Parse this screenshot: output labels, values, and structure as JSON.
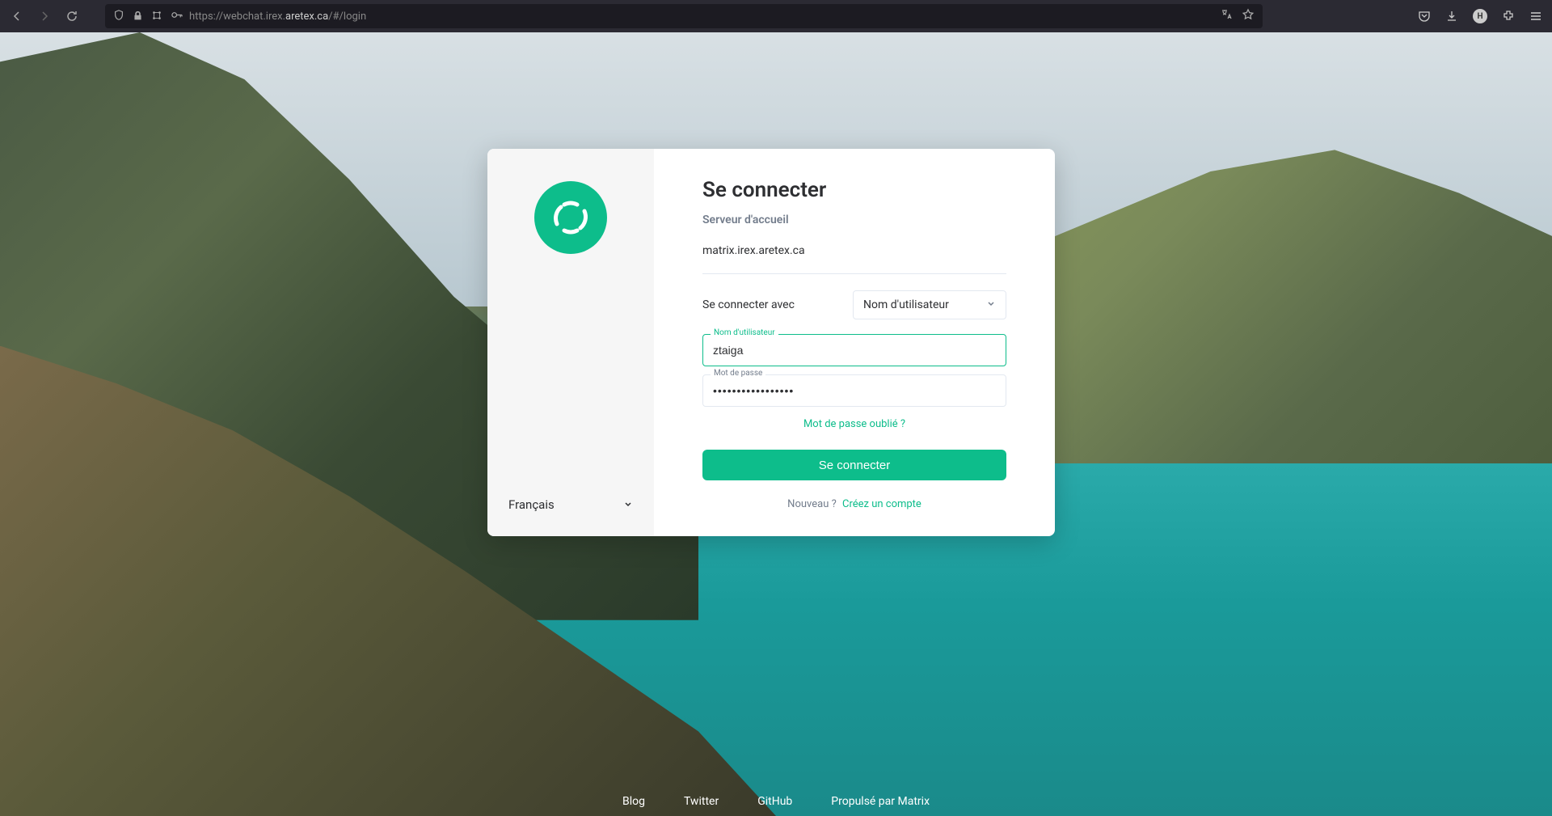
{
  "browser": {
    "url_prefix": "https://webchat.irex.",
    "url_bold": "aretex.ca",
    "url_suffix": "/#/login"
  },
  "login": {
    "heading": "Se connecter",
    "homeserver_label": "Serveur d'accueil",
    "homeserver": "matrix.irex.aretex.ca",
    "method_label": "Se connecter avec",
    "method_value": "Nom d'utilisateur",
    "username_label": "Nom d'utilisateur",
    "username_value": "ztaiga",
    "password_label": "Mot de passe",
    "password_value": "•••••••••••••••••",
    "forgot": "Mot de passe oublié ?",
    "submit": "Se connecter",
    "new_q": "Nouveau ?",
    "create_link": "Créez un compte",
    "language": "Français"
  },
  "footer": {
    "blog": "Blog",
    "twitter": "Twitter",
    "github": "GitHub",
    "matrix": "Propulsé par Matrix"
  }
}
